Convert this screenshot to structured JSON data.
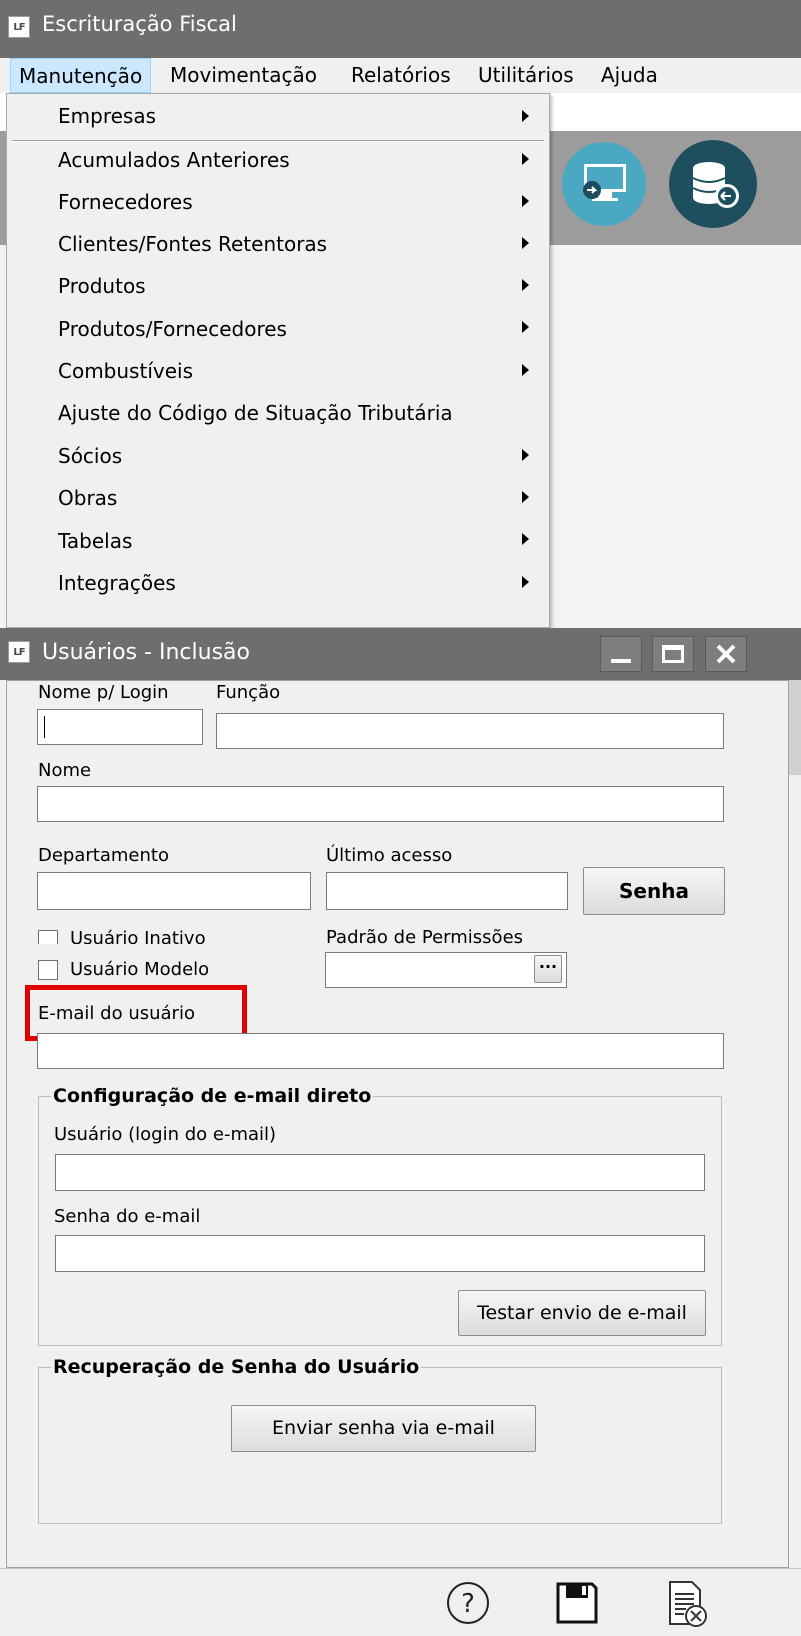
{
  "app": {
    "icon_text": "LF",
    "title": "Escrituração Fiscal"
  },
  "menubar": {
    "items": [
      "Manutenção",
      "Movimentação",
      "Relatórios",
      "Utilitários",
      "Ajuda"
    ]
  },
  "dropdown": {
    "items": [
      {
        "label": "Empresas",
        "submenu": true
      },
      {
        "label": "Acumulados Anteriores",
        "submenu": true
      },
      {
        "label": "Fornecedores",
        "submenu": true
      },
      {
        "label": "Clientes/Fontes Retentoras",
        "submenu": true
      },
      {
        "label": "Produtos",
        "submenu": true
      },
      {
        "label": "Produtos/Fornecedores",
        "submenu": true
      },
      {
        "label": "Combustíveis",
        "submenu": true
      },
      {
        "label": "Ajuste do Código de Situação Tributária",
        "submenu": false
      },
      {
        "label": "Sócios",
        "submenu": true
      },
      {
        "label": "Obras",
        "submenu": true
      },
      {
        "label": "Tabelas",
        "submenu": true
      },
      {
        "label": "Integrações",
        "submenu": true
      }
    ]
  },
  "toolbar": {
    "icons": [
      "connect-icon",
      "monitor-transfer-icon",
      "database-restore-icon"
    ]
  },
  "dialog": {
    "icon_text": "LF",
    "title": "Usuários - Inclusão",
    "fields": {
      "login_label": "Nome p/ Login",
      "login_value": "",
      "funcao_label": "Função",
      "funcao_value": "",
      "nome_label": "Nome",
      "nome_value": "",
      "departamento_label": "Departamento",
      "departamento_value": "",
      "ultimo_acesso_label": "Último acesso",
      "ultimo_acesso_value": "",
      "senha_button": "Senha",
      "usuario_inativo_label": "Usuário Inativo",
      "usuario_modelo_label": "Usuário Modelo",
      "padrao_permissoes_label": "Padrão de Permissões",
      "padrao_permissoes_value": "",
      "ellipsis_button": "···",
      "email_label": "E-mail do usuário",
      "email_value": ""
    },
    "email_config": {
      "title": "Configuração de e-mail direto",
      "usuario_label": "Usuário (login do e-mail)",
      "usuario_value": "",
      "senha_label": "Senha do e-mail",
      "senha_value": "",
      "test_button": "Testar envio de e-mail"
    },
    "recovery": {
      "title": "Recuperação de Senha do Usuário",
      "send_button": "Enviar senha via e-mail"
    },
    "footer_icons": [
      "help-icon",
      "save-icon",
      "cancel-document-icon"
    ]
  }
}
